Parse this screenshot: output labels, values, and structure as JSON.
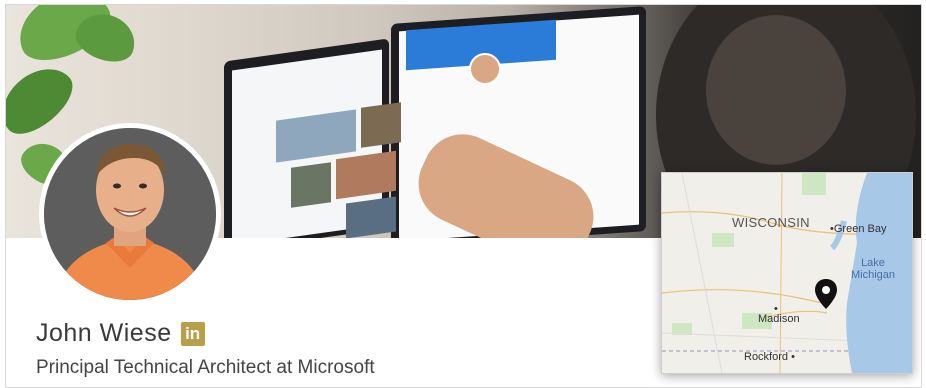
{
  "profile": {
    "name": "John Wiese",
    "linkedin_badge": "in",
    "headline": "Principal Technical Architect at Microsoft"
  },
  "map": {
    "state_label": "WISCONSIN",
    "cities": [
      {
        "name": "Green Bay"
      },
      {
        "name": "Madison"
      },
      {
        "name": "Rockford"
      }
    ],
    "lake_label": "Lake Michigan",
    "pin_icon": "map-pin-icon"
  },
  "colors": {
    "linkedin_badge": "#b8a04a",
    "name_text": "#3a3a3a",
    "lake": "#a8c8e8",
    "pin": "#111111"
  }
}
